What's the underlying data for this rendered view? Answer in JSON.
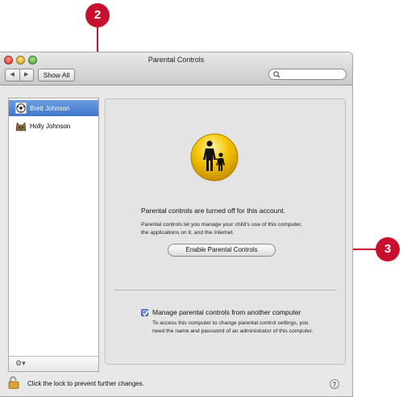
{
  "callouts": [
    "2",
    "3"
  ],
  "window": {
    "title": "Parental Controls",
    "nav_back": "◀",
    "nav_forward": "▶",
    "show_all": "Show All",
    "search_placeholder": ""
  },
  "sidebar": {
    "users": [
      {
        "name": "Brett Johnson",
        "avatar": "soccer-ball-icon",
        "selected": true
      },
      {
        "name": "Holly Johnson",
        "avatar": "cat-icon",
        "selected": false
      }
    ],
    "footer_action": "gear-menu-icon"
  },
  "panel": {
    "icon": "parent-child-icon",
    "status": "Parental controls are turned off for this account.",
    "description": "Parental controls let you manage your child’s use of this computer, the applications on it, and the Internet.",
    "enable_button": "Enable Parental Controls",
    "remote_checkbox": {
      "checked": true,
      "label": "Manage parental controls from another computer",
      "description": "To access this computer to change parental control settings, you need the name and password of an administrator of this computer."
    }
  },
  "footer": {
    "lock_text": "Click the lock to prevent further changes.",
    "help": "?"
  },
  "colors": {
    "callout": "#c8102e",
    "selection": "#3e76c9",
    "icon_yellow": "#f5c400"
  }
}
